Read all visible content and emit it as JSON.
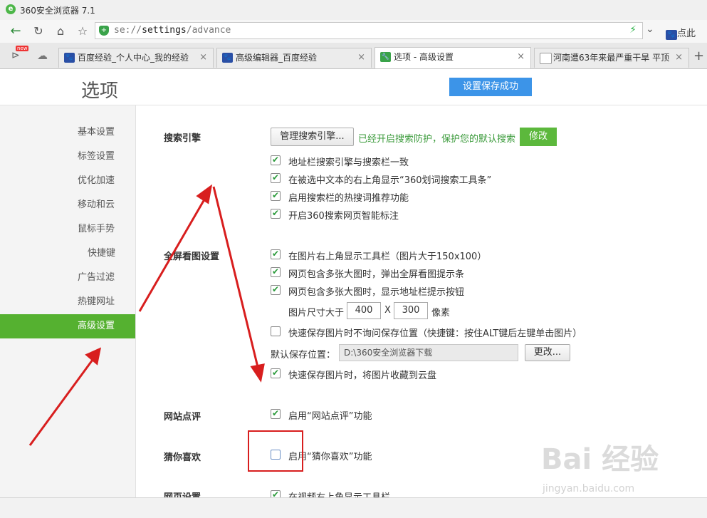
{
  "window": {
    "title": "360安全浏览器 7.1",
    "app_icon": "360-browser-logo"
  },
  "navbar": {
    "url_prefix": "se://",
    "url_strong": "settings",
    "url_suffix": "/advance",
    "right_text": "点此",
    "icons": [
      "back-arrow-icon",
      "refresh-icon",
      "home-icon",
      "star-icon",
      "shield-icon",
      "bolt-icon",
      "chevron-down-icon",
      "paw-icon"
    ]
  },
  "tabs": [
    {
      "label": "百度经验_个人中心_我的经验",
      "icon": "paw-icon",
      "active": false
    },
    {
      "label": "高级编辑器_百度经验",
      "icon": "paw-icon",
      "active": false
    },
    {
      "label": "选项 - 高级设置",
      "icon": "wrench-icon",
      "active": true
    },
    {
      "label": "河南遭63年来最严重干旱 平顶",
      "icon": "document-icon",
      "active": false
    }
  ],
  "tabbar": {
    "new_tab": "+",
    "close": "×",
    "badge": "new"
  },
  "header": {
    "title": "选项",
    "save_status": "设置保存成功"
  },
  "sidebar": {
    "items": [
      {
        "label": "基本设置",
        "active": false
      },
      {
        "label": "标签设置",
        "active": false
      },
      {
        "label": "优化加速",
        "active": false
      },
      {
        "label": "移动和云",
        "active": false
      },
      {
        "label": "鼠标手势",
        "active": false
      },
      {
        "label": "快捷键",
        "active": false
      },
      {
        "label": "广告过滤",
        "active": false
      },
      {
        "label": "热键网址",
        "active": false
      },
      {
        "label": "高级设置",
        "active": true
      }
    ]
  },
  "search": {
    "title": "搜索引擎",
    "manage_button": "管理搜索引擎...",
    "protect_text": "已经开启搜索防护，保护您的默认搜索",
    "modify_button": "修改",
    "options": [
      {
        "label": "地址栏搜索引擎与搜索栏一致",
        "checked": true
      },
      {
        "label": "在被选中文本的右上角显示“360划词搜索工具条”",
        "checked": true
      },
      {
        "label": "启用搜索栏的热搜词推荐功能",
        "checked": true
      },
      {
        "label": "开启360搜索网页智能标注",
        "checked": true
      }
    ]
  },
  "fullscreen": {
    "title": "全屏看图设置",
    "options": [
      {
        "label": "在图片右上角显示工具栏（图片大于150x100）",
        "checked": true
      },
      {
        "label": "网页包含多张大图时，弹出全屏看图提示条",
        "checked": true
      },
      {
        "label": "网页包含多张大图时，显示地址栏提示按钮",
        "checked": true
      }
    ],
    "size_label": "图片尺寸大于",
    "width": "400",
    "x": "X",
    "height": "300",
    "unit": "像素",
    "quick_save": {
      "label": "快速保存图片时不询问保存位置（快捷键：按住ALT键后左键单击图片）",
      "checked": false
    },
    "default_path_label": "默认保存位置：",
    "default_path": "D:\\360安全浏览器下载",
    "change_button": "更改...",
    "cloud": {
      "label": "快速保存图片时，将图片收藏到云盘",
      "checked": true
    }
  },
  "review": {
    "title": "网站点评",
    "option": {
      "label": "启用“网站点评”功能",
      "checked": true
    }
  },
  "guess": {
    "title": "猜你喜欢",
    "option": {
      "label": "启用“猜你喜欢”功能",
      "checked": false
    }
  },
  "webpage": {
    "title": "网页设置",
    "option": {
      "label": "在视频右上角显示工具栏",
      "checked": true
    }
  },
  "watermark": {
    "brand": "Bai 经验",
    "site": "jingyan.baidu.com"
  },
  "colors": {
    "accent_green": "#55b130",
    "save_blue": "#3c94e8",
    "annotation_red": "#d81e1e"
  }
}
